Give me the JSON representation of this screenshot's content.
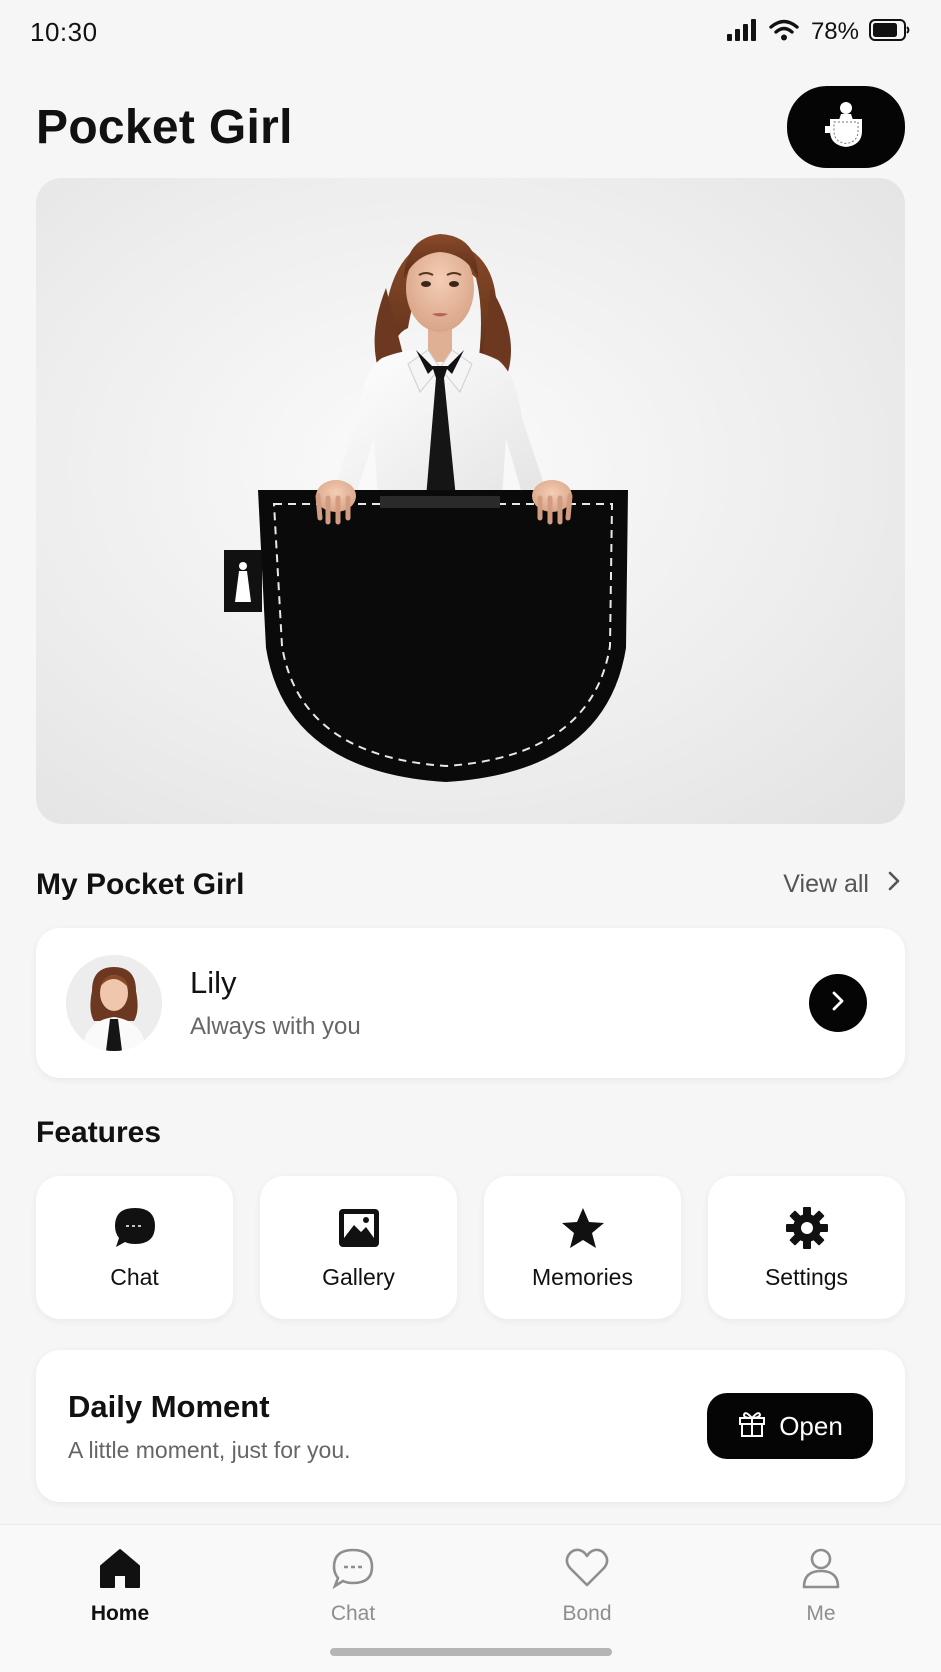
{
  "status_bar": {
    "time": "10:30",
    "battery": "78%",
    "icons": [
      "cellular-signal-icon",
      "wifi-icon",
      "battery-icon"
    ]
  },
  "header": {
    "title": "Pocket Girl",
    "action_icon": "pocket-figure-icon"
  },
  "hero": {
    "image": "woman-in-white-shirt-and-black-tie-in-black-pocket"
  },
  "my_pocket_girl": {
    "title": "My Pocket Girl",
    "view_all": "View all",
    "companion": {
      "name": "Lily",
      "tagline": "Always with you",
      "arrow_icon": "chevron-right-icon"
    }
  },
  "features": {
    "title": "Features",
    "items": [
      {
        "label": "Chat",
        "icon": "chat-bubble-icon"
      },
      {
        "label": "Gallery",
        "icon": "image-icon"
      },
      {
        "label": "Memories",
        "icon": "star-icon"
      },
      {
        "label": "Settings",
        "icon": "gear-icon"
      }
    ]
  },
  "daily_moment": {
    "title": "Daily Moment",
    "subtitle": "A little moment, just for you.",
    "button_label": "Open",
    "button_icon": "gift-icon"
  },
  "tab_bar": {
    "active": "Home",
    "tabs": [
      {
        "label": "Home",
        "icon": "home-icon"
      },
      {
        "label": "Chat",
        "icon": "chat-bubble-icon"
      },
      {
        "label": "Bond",
        "icon": "heart-icon"
      },
      {
        "label": "Me",
        "icon": "person-icon"
      }
    ]
  },
  "colors": {
    "background": "#f6f6f6",
    "card": "#ffffff",
    "accent": "#050505",
    "muted_text": "#666666",
    "inactive_tab": "#8e8e8e"
  }
}
